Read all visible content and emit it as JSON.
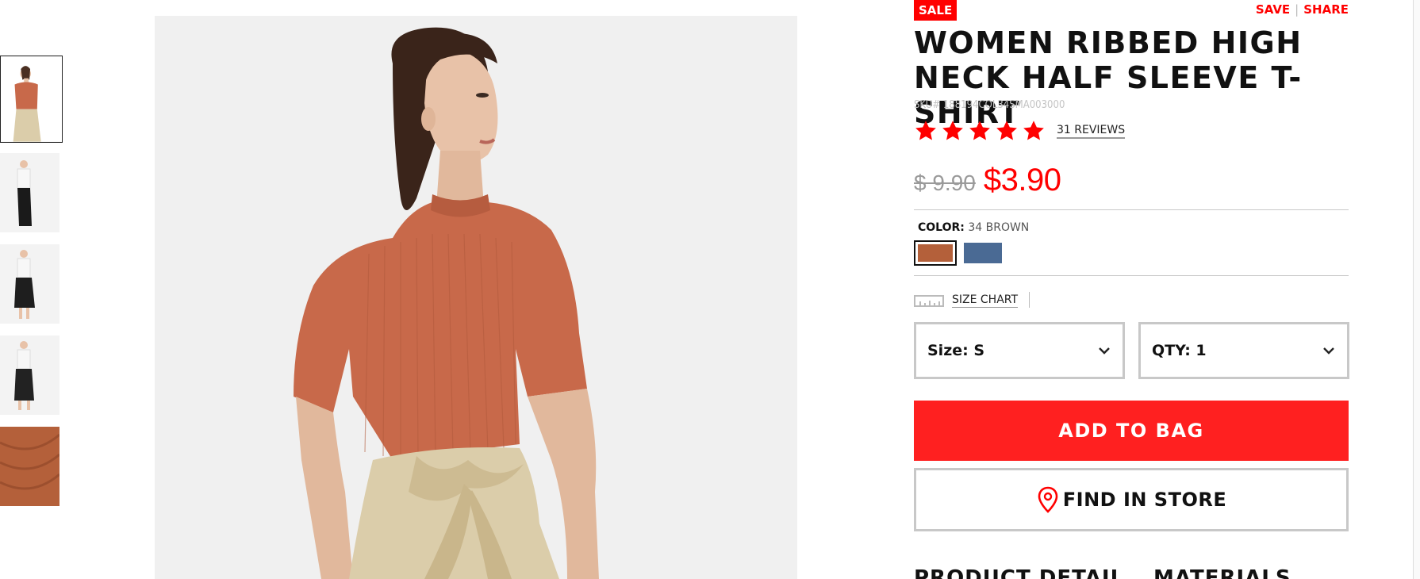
{
  "badge": {
    "sale": "SALE"
  },
  "top_links": {
    "save": "SAVE",
    "separator": "|",
    "share": "SHARE"
  },
  "product": {
    "title": "WOMEN RIBBED HIGH NECK HALF SLEEVE T-SHIRT",
    "sku": "SKU# 188194COL34SMA003000",
    "rating": {
      "stars": 5,
      "reviews_label": "31 REVIEWS"
    },
    "price_original": "$ 9.90",
    "price_sale": "$3.90"
  },
  "color": {
    "label": "COLOR:",
    "selected": "34 BROWN",
    "swatches": [
      {
        "name": "34 BROWN",
        "hex": "#b4603a",
        "selected": true
      },
      {
        "name": "BLUE",
        "hex": "#4a6a94",
        "selected": false
      }
    ]
  },
  "size_chart": {
    "label": "SIZE CHART",
    "icon": "ruler-icon"
  },
  "selectors": {
    "size": {
      "label": "Size: S"
    },
    "qty": {
      "label": "QTY: 1"
    }
  },
  "actions": {
    "add_to_bag": "ADD TO BAG",
    "find_in_store": "FIND IN STORE"
  },
  "sections": {
    "product_detail": "PRODUCT DETAIL",
    "materials": "MATERIALS"
  },
  "thumbnails": [
    {
      "name": "thumb-front-tshirt",
      "active": true
    },
    {
      "name": "thumb-white-top-black-pants",
      "active": false
    },
    {
      "name": "thumb-white-top-black-culottes",
      "active": false
    },
    {
      "name": "thumb-white-top-black-pants-2",
      "active": false
    },
    {
      "name": "thumb-fabric-closeup",
      "active": false
    }
  ],
  "colors": {
    "accent": "#ff0000",
    "button_red": "#ff2020",
    "border_gray": "#c8c8c8",
    "shirt": "#c8694a",
    "skirt": "#dbcdaa",
    "image_bg": "#f0f0f0"
  }
}
